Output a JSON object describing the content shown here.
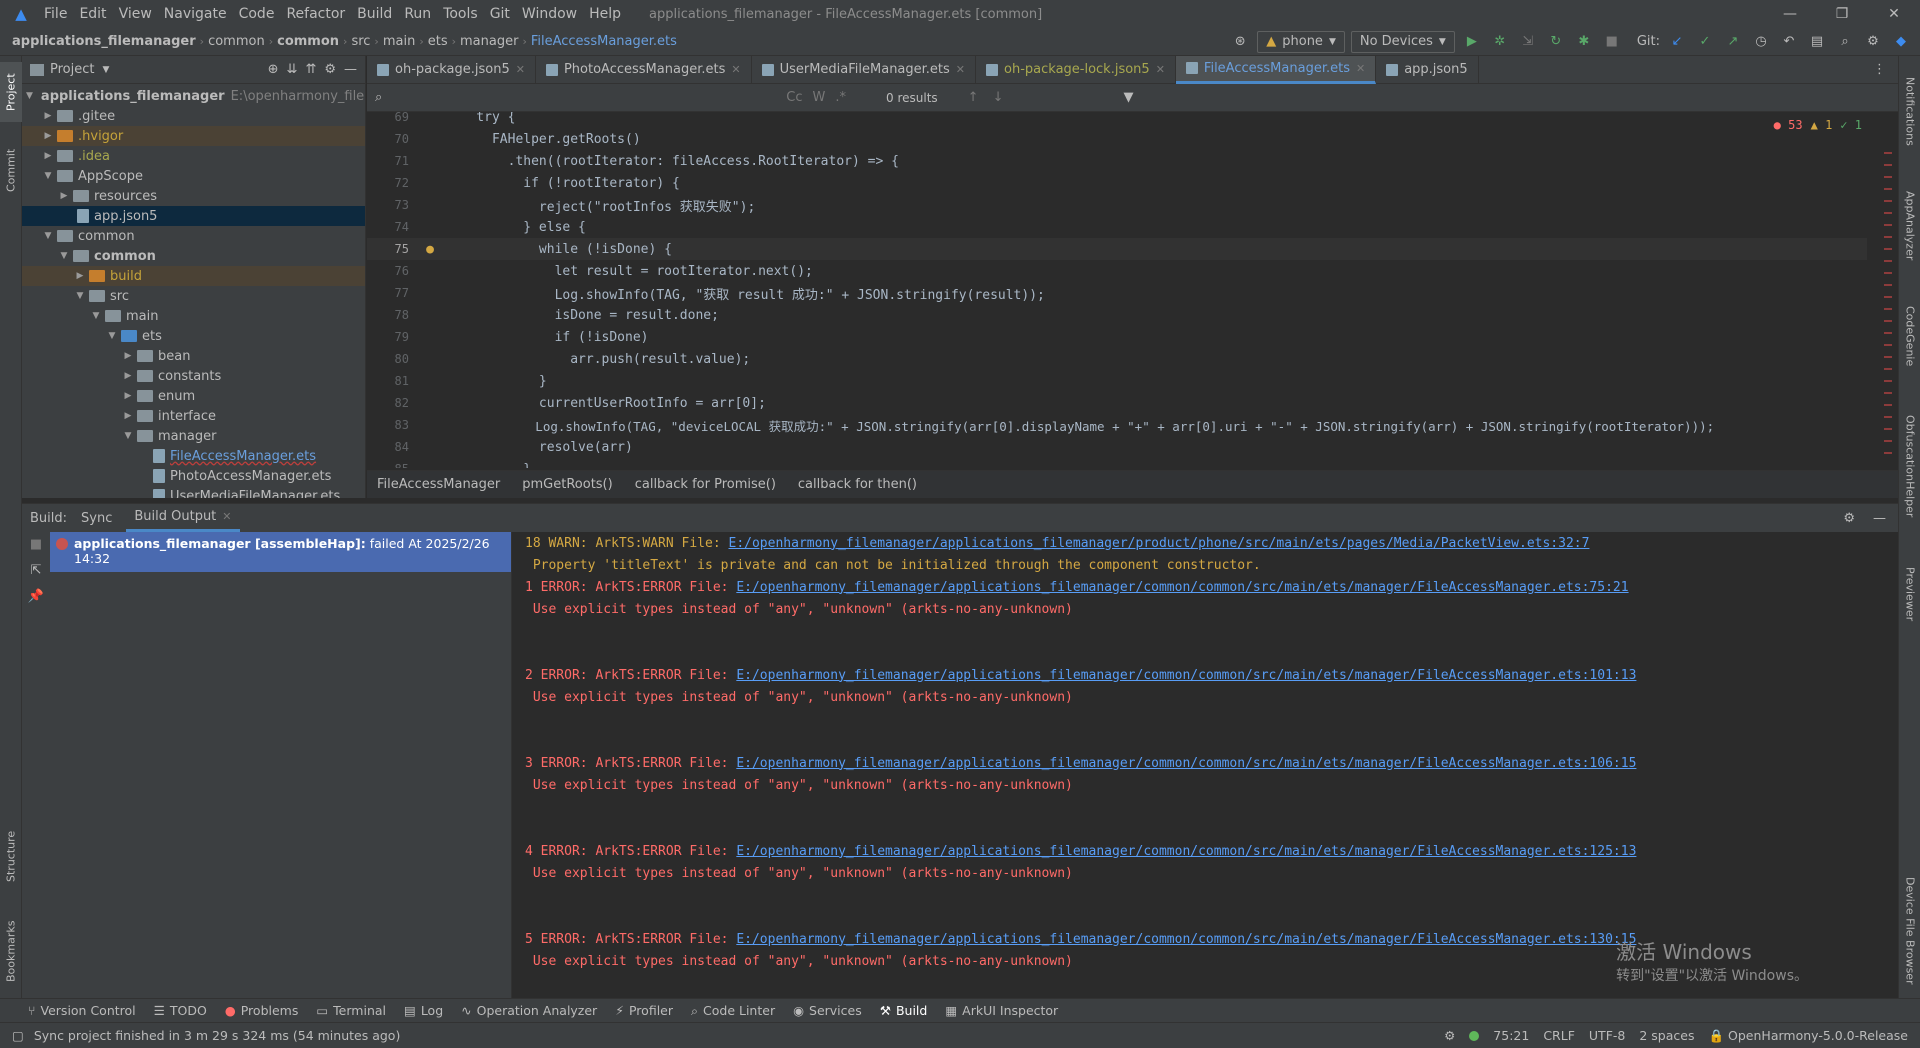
{
  "menubar": {
    "items": [
      "File",
      "Edit",
      "View",
      "Navigate",
      "Code",
      "Refactor",
      "Build",
      "Run",
      "Tools",
      "Git",
      "Window",
      "Help"
    ],
    "title": "applications_filemanager - FileAccessManager.ets [common]"
  },
  "breadcrumb": [
    "applications_filemanager",
    "common",
    "common",
    "src",
    "main",
    "ets",
    "manager",
    "FileAccessManager.ets"
  ],
  "navtools": {
    "device": "phone",
    "devices": "No Devices",
    "git_label": "Git:"
  },
  "project_panel": {
    "title": "Project",
    "tree": [
      {
        "label": "applications_filemanager",
        "extra": "E:\\openharmony_filemar"
      },
      {
        "label": ".gitee"
      },
      {
        "label": ".hvigor"
      },
      {
        "label": ".idea"
      },
      {
        "label": "AppScope"
      },
      {
        "label": "resources"
      },
      {
        "label": "app.json5"
      },
      {
        "label": "common"
      },
      {
        "label": "common"
      },
      {
        "label": "build"
      },
      {
        "label": "src"
      },
      {
        "label": "main"
      },
      {
        "label": "ets"
      },
      {
        "label": "bean"
      },
      {
        "label": "constants"
      },
      {
        "label": "enum"
      },
      {
        "label": "interface"
      },
      {
        "label": "manager"
      },
      {
        "label": "FileAccessManager.ets"
      },
      {
        "label": "PhotoAccessManager.ets"
      },
      {
        "label": "UserMediaFileManager.ets"
      }
    ]
  },
  "left_strip": [
    "Project",
    "Commit",
    "Structure",
    "Bookmarks"
  ],
  "right_strip": [
    "Notifications",
    "AppAnalyzer",
    "CodeGenie",
    "ObfuscationHelper",
    "Previewer",
    "Device File Browser"
  ],
  "editor_tabs": [
    "oh-package.json5",
    "PhotoAccessManager.ets",
    "UserMediaFileManager.ets",
    "oh-package-lock.json5",
    "FileAccessManager.ets",
    "app.json5"
  ],
  "search": {
    "results": "0 results"
  },
  "inspections": {
    "errors": "53",
    "warnings": "1",
    "ok": "1"
  },
  "code_lines": [
    {
      "n": "69",
      "t": "    try {"
    },
    {
      "n": "70",
      "t": "      FAHelper.getRoots()"
    },
    {
      "n": "71",
      "t": "        .then((rootIterator: fileAccess.RootIterator) => {"
    },
    {
      "n": "72",
      "t": "          if (!rootIterator) {"
    },
    {
      "n": "73",
      "t": "            reject(\"rootInfos 获取失败\");"
    },
    {
      "n": "74",
      "t": "          } else {"
    },
    {
      "n": "75",
      "t": "            while (!isDone) {"
    },
    {
      "n": "76",
      "t": "              let result = rootIterator.next();"
    },
    {
      "n": "77",
      "t": "              Log.showInfo(TAG, \"获取 result 成功:\" + JSON.stringify(result));"
    },
    {
      "n": "78",
      "t": "              isDone = result.done;"
    },
    {
      "n": "79",
      "t": "              if (!isDone)"
    },
    {
      "n": "80",
      "t": "                arr.push(result.value);"
    },
    {
      "n": "81",
      "t": "            }"
    },
    {
      "n": "82",
      "t": "            currentUserRootInfo = arr[0];"
    },
    {
      "n": "83",
      "t": "            Log.showInfo(TAG, \"deviceLOCAL 获取成功:\" + JSON.stringify(arr[0].displayName + \"+\" + arr[0].uri + \"-\" + JSON.stringify(arr) + JSON.stringify(rootIterator)));"
    },
    {
      "n": "84",
      "t": "            resolve(arr)"
    },
    {
      "n": "85",
      "t": "          }"
    }
  ],
  "code_breadcrumb": [
    "FileAccessManager",
    "pmGetRoots()",
    "callback for Promise()",
    "callback for then()"
  ],
  "build_panel": {
    "label": "Build:",
    "tabs": [
      "Sync",
      "Build Output"
    ],
    "task_name": "applications_filemanager [assembleHap]:",
    "task_status": "failed At 2025/2/26 14:32",
    "output": [
      {
        "kind": "warn",
        "prefix": "18 WARN: ArkTS:WARN File: ",
        "link": "E:/openharmony_filemanager/applications_filemanager/product/phone/src/main/ets/pages/Media/PacketView.ets:32:7"
      },
      {
        "kind": "warn",
        "text": " Property 'titleText' is private and can not be initialized through the component constructor."
      },
      {
        "kind": "err",
        "prefix": "1 ERROR: ArkTS:ERROR File: ",
        "link": "E:/openharmony_filemanager/applications_filemanager/common/common/src/main/ets/manager/FileAccessManager.ets:75:21"
      },
      {
        "kind": "err",
        "text": " Use explicit types instead of \"any\", \"unknown\" (arkts-no-any-unknown)"
      },
      {
        "kind": "err",
        "prefix": "2 ERROR: ArkTS:ERROR File: ",
        "link": "E:/openharmony_filemanager/applications_filemanager/common/common/src/main/ets/manager/FileAccessManager.ets:101:13"
      },
      {
        "kind": "err",
        "text": " Use explicit types instead of \"any\", \"unknown\" (arkts-no-any-unknown)"
      },
      {
        "kind": "err",
        "prefix": "3 ERROR: ArkTS:ERROR File: ",
        "link": "E:/openharmony_filemanager/applications_filemanager/common/common/src/main/ets/manager/FileAccessManager.ets:106:15"
      },
      {
        "kind": "err",
        "text": " Use explicit types instead of \"any\", \"unknown\" (arkts-no-any-unknown)"
      },
      {
        "kind": "err",
        "prefix": "4 ERROR: ArkTS:ERROR File: ",
        "link": "E:/openharmony_filemanager/applications_filemanager/common/common/src/main/ets/manager/FileAccessManager.ets:125:13"
      },
      {
        "kind": "err",
        "text": " Use explicit types instead of \"any\", \"unknown\" (arkts-no-any-unknown)"
      },
      {
        "kind": "err",
        "prefix": "5 ERROR: ArkTS:ERROR File: ",
        "link": "E:/openharmony_filemanager/applications_filemanager/common/common/src/main/ets/manager/FileAccessManager.ets:130:15"
      },
      {
        "kind": "err",
        "text": " Use explicit types instead of \"any\", \"unknown\" (arkts-no-any-unknown)"
      }
    ]
  },
  "watermark": {
    "line1": "激活 Windows",
    "line2": "转到\"设置\"以激活 Windows。"
  },
  "toolwindows": [
    "Version Control",
    "TODO",
    "Problems",
    "Terminal",
    "Log",
    "Operation Analyzer",
    "Profiler",
    "Code Linter",
    "Services",
    "Build",
    "ArkUI Inspector"
  ],
  "status": {
    "message": "Sync project finished in 3 m 29 s 324 ms (54 minutes ago)",
    "position": "75:21",
    "line_sep": "CRLF",
    "encoding": "UTF-8",
    "indent": "2 spaces",
    "sdk": "OpenHarmony-5.0.0-Release"
  }
}
